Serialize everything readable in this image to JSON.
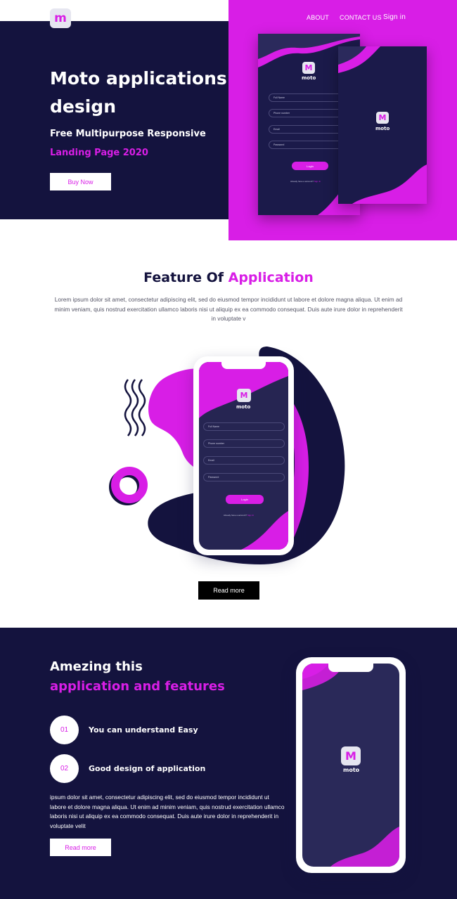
{
  "brand": {
    "logo_letter": "m",
    "accent": "#d81ee6",
    "dark": "#14133e"
  },
  "nav": {
    "about": "ABOUT",
    "contact": "CONTACT US",
    "signin": "Sign in"
  },
  "hero": {
    "title": "Moto applications design",
    "subtitle_line1": "Free Multipurpose Responsive",
    "subtitle_line2": "Landing Page 2020",
    "button": "Buy Now"
  },
  "login_mockup": {
    "logo_letter": "M",
    "brand_word": "moto",
    "fields": [
      "Full Name",
      "Phone number",
      "Email",
      "Password"
    ],
    "button": "Login",
    "footer_text": "Already have a account?",
    "footer_link": "Sign In"
  },
  "feature": {
    "title_plain": "Feature Of",
    "title_accent": "Application",
    "description": "Lorem ipsum dolor sit amet, consectetur adipiscing elit, sed do eiusmod tempor incididunt ut labore et dolore magna aliqua. Ut enim ad minim veniam, quis nostrud exercitation ullamco laboris nisi ut aliquip ex ea commodo consequat. Duis aute irure dolor in reprehenderit in voluptate v",
    "button": "Read more"
  },
  "amazing": {
    "title_line1": "Amezing this",
    "title_line2": "application and features",
    "points": [
      {
        "num": "01",
        "label": "You can understand Easy"
      },
      {
        "num": "02",
        "label": "Good design of application"
      }
    ],
    "description": "ipsum dolor sit amet, consectetur adipiscing elit, sed do eiusmod tempor incididunt ut labore et dolore magna aliqua. Ut enim ad minim veniam, quis nostrud exercitation ullamco laboris nisi ut aliquip ex ea commodo consequat. Duis aute irure dolor in reprehenderit in voluptate velit",
    "button": "Read more",
    "phone_logo_letter": "M",
    "phone_brand_word": "moto"
  }
}
